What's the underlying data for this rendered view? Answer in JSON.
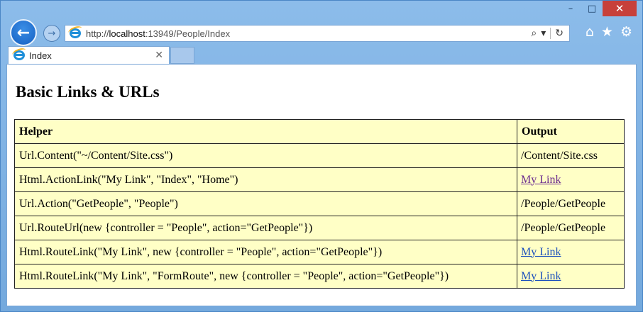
{
  "window": {
    "caption": {
      "minimize": "–",
      "maximize": "□",
      "close": "✕"
    }
  },
  "nav": {
    "back_icon": "back-arrow-icon",
    "forward_icon": "forward-arrow-icon",
    "address": {
      "prefix": "http://",
      "host": "localhost",
      "rest": ":13949/People/Index"
    },
    "search_icon": "⌕",
    "dropdown_icon": "▾",
    "refresh_icon": "↻",
    "home_icon": "⌂",
    "favorites_icon": "★",
    "settings_icon": "⚙"
  },
  "tab": {
    "label": "Index",
    "close": "✕"
  },
  "page": {
    "title": "Basic Links & URLs",
    "table": {
      "headers": [
        "Helper",
        "Output"
      ],
      "rows": [
        {
          "helper": "Url.Content(\"~/Content/Site.css\")",
          "output": "/Content/Site.css",
          "is_link": false
        },
        {
          "helper": "Html.ActionLink(\"My Link\", \"Index\", \"Home\")",
          "output": "My Link",
          "is_link": true,
          "visited": true
        },
        {
          "helper": "Url.Action(\"GetPeople\", \"People\")",
          "output": "/People/GetPeople",
          "is_link": false
        },
        {
          "helper": "Url.RouteUrl(new {controller = \"People\", action=\"GetPeople\"})",
          "output": "/People/GetPeople",
          "is_link": false
        },
        {
          "helper": "Html.RouteLink(\"My Link\", new {controller = \"People\", action=\"GetPeople\"})",
          "output": "My Link",
          "is_link": true,
          "visited": false
        },
        {
          "helper": "Html.RouteLink(\"My Link\", \"FormRoute\", new {controller = \"People\", action=\"GetPeople\"})",
          "output": "My Link",
          "is_link": true,
          "visited": false
        }
      ]
    }
  },
  "colors": {
    "table_bg": "#ffffc6",
    "link": "#1a4fbd",
    "visited_link": "#6a2a8e",
    "close_button": "#c7403a"
  }
}
